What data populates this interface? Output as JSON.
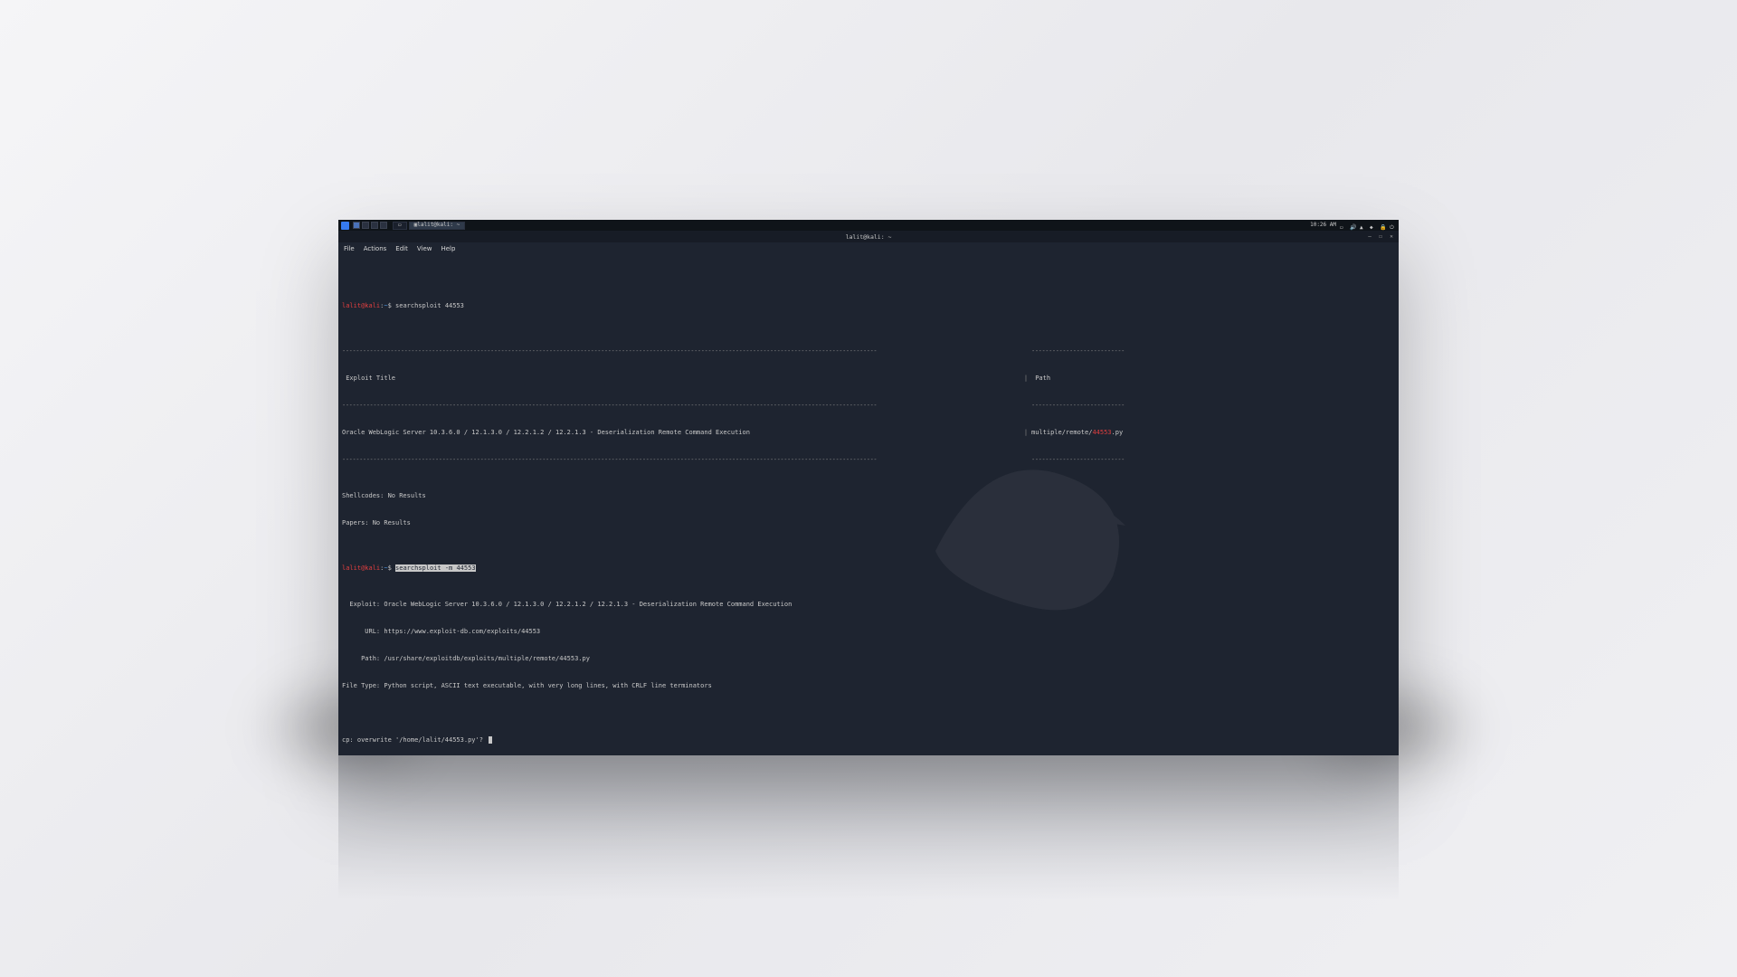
{
  "taskbar": {
    "app_label": "lalit@kali: ~",
    "clock": "10:26 AM"
  },
  "window": {
    "title": "lalit@kali: ~"
  },
  "menubar": {
    "file": "File",
    "actions": "Actions",
    "edit": "Edit",
    "view": "View",
    "help": "Help"
  },
  "terminal": {
    "prompt_user": "lalit@kali",
    "prompt_sep": ":",
    "prompt_path": "~",
    "prompt_sym": "$",
    "cmd1": "searchsploit 44553",
    "header_left": " Exploit Title",
    "header_right": " Path",
    "result_left": "Oracle WebLogic Server 10.3.6.0 / 12.1.3.0 / 12.2.1.2 / 12.2.1.3 - Deserialization Remote Command Execution",
    "result_right_pre": "multiple/remote/",
    "result_right_hl": "44553",
    "result_right_post": ".py",
    "shellcodes": "Shellcodes: No Results",
    "papers": "Papers: No Results",
    "cmd2_sel": "searchsploit -m 44553",
    "exploit_line": "  Exploit: Oracle WebLogic Server 10.3.6.0 / 12.1.3.0 / 12.2.1.2 / 12.2.1.3 - Deserialization Remote Command Execution",
    "url_line": "      URL: https://www.exploit-db.com/exploits/44553",
    "path_line": "     Path: /usr/share/exploitdb/exploits/multiple/remote/44553.py",
    "filetype_line": "File Type: Python script, ASCII text executable, with very long lines, with CRLF line terminators",
    "cp_prompt": "cp: overwrite '/home/lalit/44553.py'? "
  },
  "dash": "--------------------------------------------------------------------------------------------------------------------------------------------------------------------------------------------------------------",
  "dash_short_l": "-----------------------------------------------------------------------------------------------------------------------------------------------------------",
  "dash_short_r": "---------------------------"
}
